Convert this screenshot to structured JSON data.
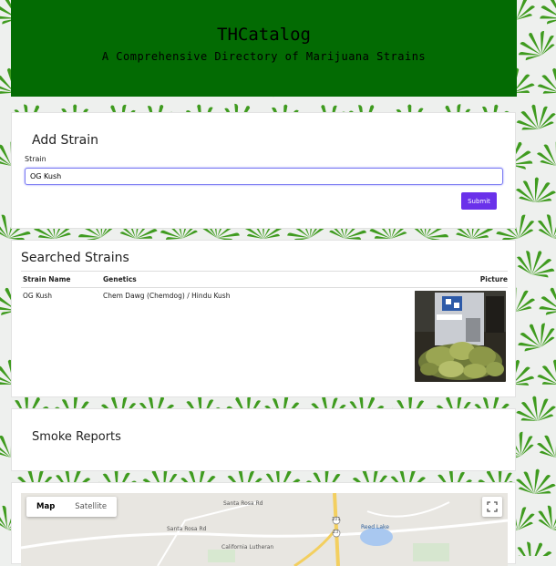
{
  "header": {
    "title": "THCatalog",
    "subtitle": "A Comprehensive Directory of Marijuana Strains"
  },
  "add_strain": {
    "title": "Add Strain",
    "field_label": "Strain",
    "field_value": "OG Kush",
    "submit_label": "Submit"
  },
  "searched": {
    "title": "Searched Strains",
    "columns": [
      "Strain Name",
      "Genetics",
      "Picture"
    ],
    "rows": [
      {
        "name": "OG Kush",
        "genetics": "Chem Dawg (Chemdog) / Hindu Kush"
      }
    ]
  },
  "smoke_reports": {
    "title": "Smoke Reports"
  },
  "map": {
    "map_type_active": "Map",
    "map_type_other": "Satellite",
    "labels": [
      "Santa Rosa Rd",
      "Santa Rosa Rd",
      "California Lutheran",
      "Reed Lake",
      "101",
      "23"
    ]
  },
  "colors": {
    "header_bg": "#036b03",
    "submit_bg": "#6a31ea",
    "input_focus": "#7b7bf2"
  }
}
